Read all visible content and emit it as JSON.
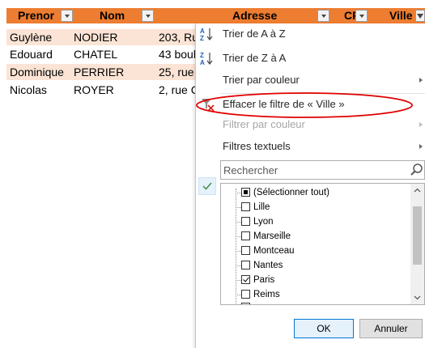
{
  "headers": [
    {
      "label": "Prenor",
      "filter_icon": "dropdown-arrow-icon"
    },
    {
      "label": "Nom",
      "filter_icon": "dropdown-arrow-icon"
    },
    {
      "label": "Adresse",
      "filter_icon": "dropdown-arrow-icon"
    },
    {
      "label": "CP",
      "filter_icon": "dropdown-arrow-icon"
    },
    {
      "label": "Ville",
      "filter_icon": "filter-funnel-icon"
    }
  ],
  "rows": [
    {
      "prenom": "Guylène",
      "nom": "NODIER",
      "adresse": "203, Ru"
    },
    {
      "prenom": "Edouard",
      "nom": "CHATEL",
      "adresse": "43 boul"
    },
    {
      "prenom": "Dominique",
      "nom": "PERRIER",
      "adresse": "25, rue"
    },
    {
      "prenom": "Nicolas",
      "nom": "ROYER",
      "adresse": "2, rue C"
    }
  ],
  "menu": {
    "sort_az": "Trier de A à Z",
    "sort_za": "Trier de Z à A",
    "sort_color": "Trier par couleur",
    "clear_filter": "Effacer le filtre de « Ville »",
    "filter_color": "Filtrer par couleur",
    "text_filters": "Filtres textuels"
  },
  "search": {
    "placeholder": "Rechercher"
  },
  "list": [
    {
      "label": "(Sélectionner tout)",
      "state": "partial"
    },
    {
      "label": "Lille",
      "state": "unchecked"
    },
    {
      "label": "Lyon",
      "state": "unchecked"
    },
    {
      "label": "Marseille",
      "state": "unchecked"
    },
    {
      "label": "Montceau",
      "state": "unchecked"
    },
    {
      "label": "Nantes",
      "state": "unchecked"
    },
    {
      "label": "Paris",
      "state": "checked"
    },
    {
      "label": "Reims",
      "state": "unchecked"
    },
    {
      "label": "",
      "state": "unchecked"
    }
  ],
  "buttons": {
    "ok": "OK",
    "cancel": "Annuler"
  },
  "colors": {
    "header": "#ed7d31",
    "band": "#fbe4d5",
    "annotation": "#e00000"
  }
}
